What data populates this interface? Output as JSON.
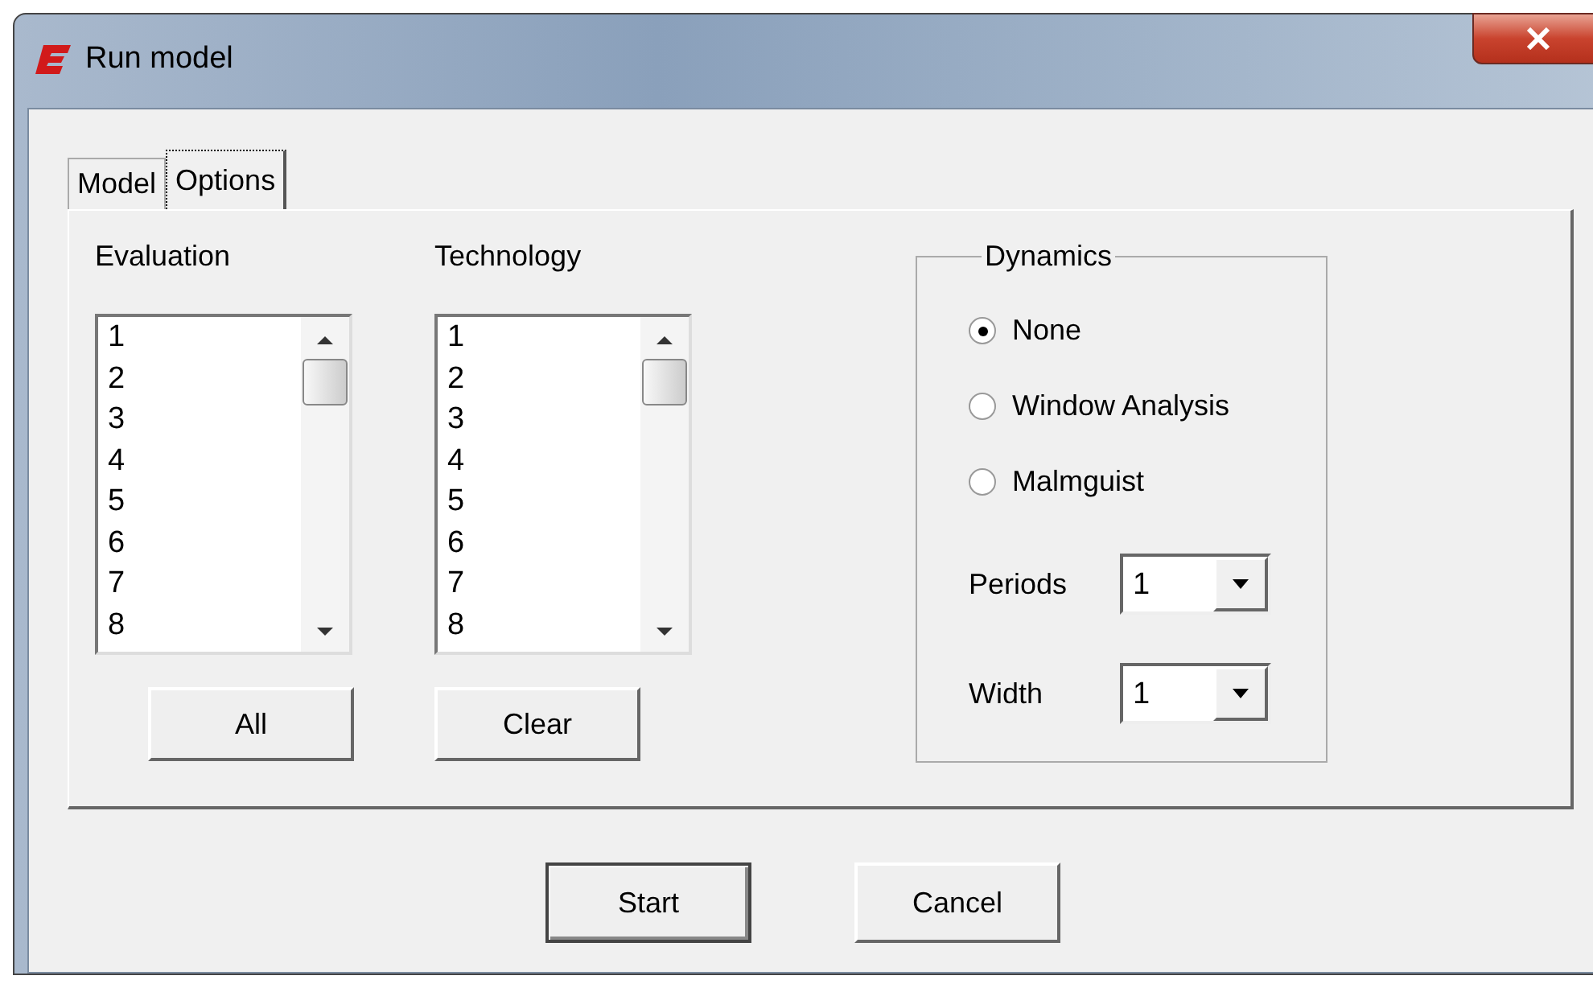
{
  "window": {
    "title": "Run model"
  },
  "tabs": [
    {
      "label": "Model",
      "selected": false
    },
    {
      "label": "Options",
      "selected": true
    }
  ],
  "lists": [
    {
      "label": "Evaluation",
      "items": [
        "1",
        "2",
        "3",
        "4",
        "5",
        "6",
        "7",
        "8"
      ],
      "button": "All"
    },
    {
      "label": "Technology",
      "items": [
        "1",
        "2",
        "3",
        "4",
        "5",
        "6",
        "7",
        "8"
      ],
      "button": "Clear"
    }
  ],
  "dynamics": {
    "title": "Dynamics",
    "options": [
      {
        "label": "None",
        "selected": true
      },
      {
        "label": "Window Analysis",
        "selected": false
      },
      {
        "label": "Malmguist",
        "selected": false
      }
    ],
    "fields": [
      {
        "label": "Periods",
        "value": "1"
      },
      {
        "label": "Width",
        "value": "1"
      }
    ]
  },
  "buttons": [
    {
      "label": "Start",
      "default": true
    },
    {
      "label": "Cancel",
      "default": false
    }
  ]
}
